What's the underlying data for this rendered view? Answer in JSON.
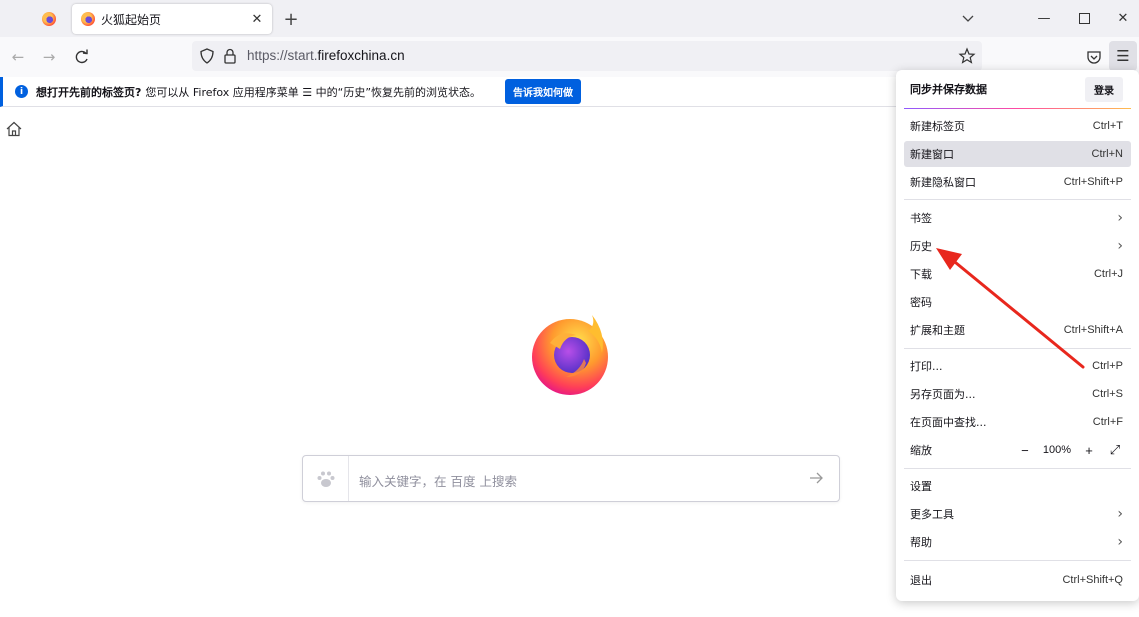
{
  "tab": {
    "title": "火狐起始页",
    "close_icon": "close-icon"
  },
  "toolbar": {
    "url_prefix": "https://start.",
    "url_domain": "firefoxchina.cn"
  },
  "notification": {
    "bold": "想打开先前的标签页?",
    "text": "您可以从 Firefox 应用程序菜单 ☰ 中的“历史”恢复先前的浏览状态。",
    "button": "告诉我如何做"
  },
  "search": {
    "placeholder": "输入关键字，在 百度 上搜索"
  },
  "menu": {
    "header": "同步并保存数据",
    "signin": "登录",
    "items": [
      {
        "label": "新建标签页",
        "shortcut": "Ctrl+T"
      },
      {
        "label": "新建窗口",
        "shortcut": "Ctrl+N"
      },
      {
        "label": "新建隐私窗口",
        "shortcut": "Ctrl+Shift+P"
      },
      {
        "label": "书签",
        "shortcut": ""
      },
      {
        "label": "历史",
        "shortcut": ""
      },
      {
        "label": "下载",
        "shortcut": "Ctrl+J"
      },
      {
        "label": "密码",
        "shortcut": ""
      },
      {
        "label": "扩展和主题",
        "shortcut": "Ctrl+Shift+A"
      },
      {
        "label": "打印...",
        "shortcut": "Ctrl+P"
      },
      {
        "label": "另存页面为...",
        "shortcut": "Ctrl+S"
      },
      {
        "label": "在页面中查找...",
        "shortcut": "Ctrl+F"
      },
      {
        "label": "缩放",
        "shortcut": ""
      },
      {
        "label": "设置",
        "shortcut": ""
      },
      {
        "label": "更多工具",
        "shortcut": ""
      },
      {
        "label": "帮助",
        "shortcut": ""
      },
      {
        "label": "退出",
        "shortcut": "Ctrl+Shift+Q"
      }
    ],
    "zoom": {
      "minus": "−",
      "value": "100%",
      "plus": "+"
    }
  },
  "colors": {
    "accent": "#0060df",
    "annotation_arrow": "#e8271d"
  }
}
